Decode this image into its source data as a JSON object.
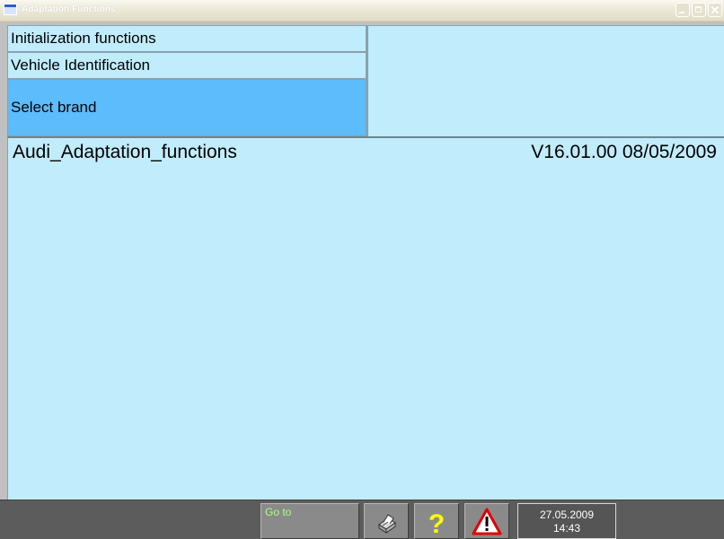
{
  "window": {
    "title": "Adaptation Functions"
  },
  "navigation": {
    "steps": [
      {
        "label": "Initialization functions"
      },
      {
        "label": "Vehicle Identification"
      },
      {
        "label": "Select brand",
        "selected": true
      }
    ]
  },
  "content": {
    "module_name": "Audi_Adaptation_functions",
    "version": "V16.01.00 08/05/2009"
  },
  "toolbar": {
    "goto_label": "Go to",
    "print_icon": "printer-icon",
    "help_icon": "question-mark-icon",
    "warning_icon": "warning-icon",
    "date": "27.05.2009",
    "time": "14:43"
  },
  "colors": {
    "panel_background": "#c0ecfc",
    "selected_step": "#5cbcfc",
    "toolbar_background": "#5c5c5c",
    "goto_text": "#a8ff7a",
    "help_icon": "#ffff00",
    "warning_icon": "#e00000"
  }
}
